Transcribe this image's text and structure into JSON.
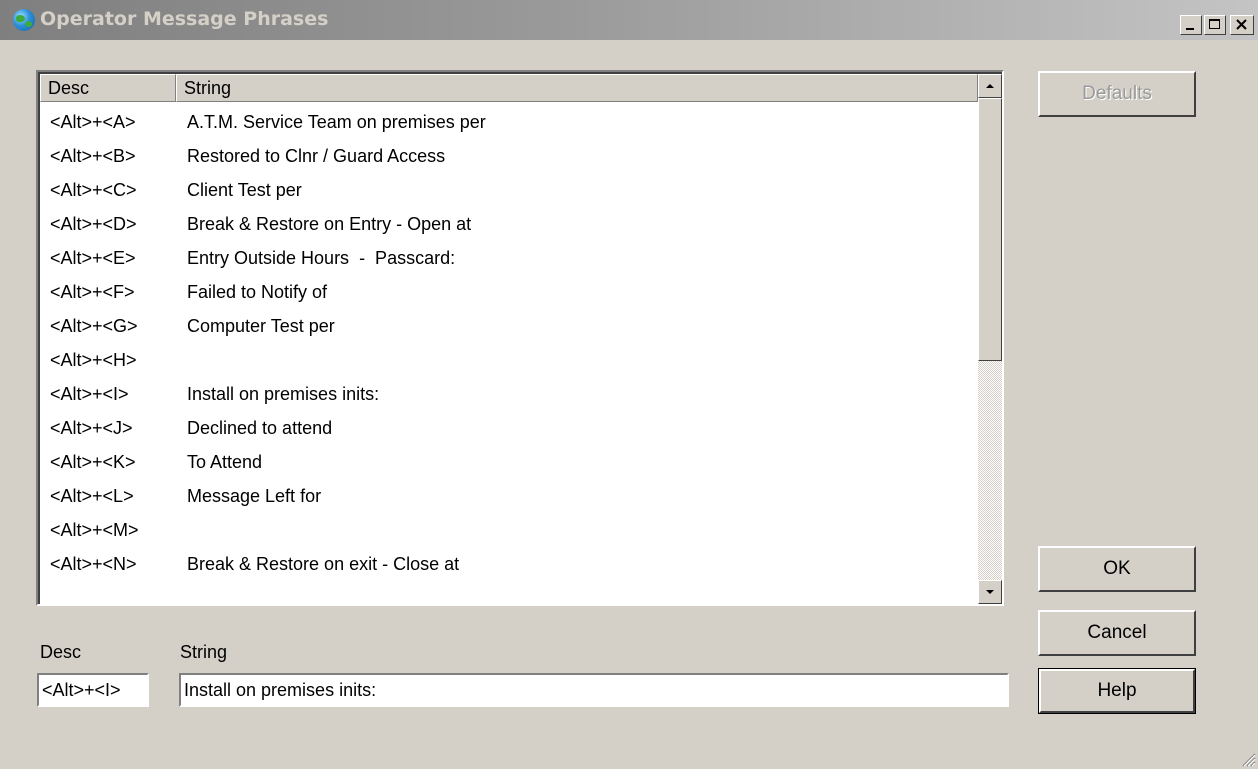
{
  "window": {
    "title": "Operator Message Phrases"
  },
  "list": {
    "columns": [
      "Desc",
      "String"
    ],
    "rows": [
      {
        "desc": "<Alt>+<A>",
        "string": "A.T.M. Service Team on premises per"
      },
      {
        "desc": "<Alt>+<B>",
        "string": "Restored to Clnr / Guard Access"
      },
      {
        "desc": "<Alt>+<C>",
        "string": "Client Test per"
      },
      {
        "desc": "<Alt>+<D>",
        "string": "Break & Restore on Entry - Open at"
      },
      {
        "desc": "<Alt>+<E>",
        "string": "Entry Outside Hours  -  Passcard:"
      },
      {
        "desc": "<Alt>+<F>",
        "string": "Failed to Notify of"
      },
      {
        "desc": "<Alt>+<G>",
        "string": "Computer Test per"
      },
      {
        "desc": "<Alt>+<H>",
        "string": ""
      },
      {
        "desc": "<Alt>+<I>",
        "string": "Install on premises inits:"
      },
      {
        "desc": "<Alt>+<J>",
        "string": "Declined to attend"
      },
      {
        "desc": "<Alt>+<K>",
        "string": "To Attend"
      },
      {
        "desc": "<Alt>+<L>",
        "string": "Message Left for"
      },
      {
        "desc": "<Alt>+<M>",
        "string": ""
      },
      {
        "desc": "<Alt>+<N>",
        "string": "Break & Restore on exit - Close at"
      }
    ]
  },
  "buttons": {
    "defaults": "Defaults",
    "ok": "OK",
    "cancel": "Cancel",
    "help": "Help"
  },
  "editor": {
    "desc_label": "Desc",
    "string_label": "String",
    "desc_value": "<Alt>+<I>",
    "string_value": "Install on premises inits:"
  },
  "icons": {
    "app": "globe-icon",
    "minimize": "minimize-icon",
    "maximize": "maximize-icon",
    "close": "close-icon",
    "scroll_up": "arrow-up-icon",
    "scroll_down": "arrow-down-icon",
    "resize": "resize-grip-icon"
  },
  "colors": {
    "face": "#d4d0c8",
    "title_text": "#d4d0c8",
    "disabled_text": "#9a9a9a"
  }
}
